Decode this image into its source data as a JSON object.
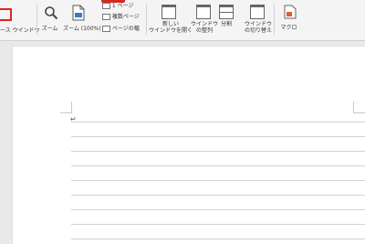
{
  "ribbon": {
    "source_window_label": "ース ウインドウ",
    "zoom_label": "ズーム",
    "zoom100_label": "ズーム (100%)",
    "one_page_label": "1 ページ",
    "multi_page_label": "複数ページ",
    "page_width_label": "ページの幅",
    "new_window_label_1": "新しい",
    "new_window_label_2": "ウインドウを開く",
    "arrange_label_1": "ウインドウ",
    "arrange_label_2": "の整列",
    "split_label": "分割",
    "switch_label_1": "ウインドウ",
    "switch_label_2": "の切り替え",
    "macro_label": "マクロ"
  },
  "cursor_symbol": "↵",
  "colors": {
    "highlight": "#e2231a",
    "ribbon_bg": "#f4f4f4",
    "canvas_bg": "#e9e9e9"
  }
}
